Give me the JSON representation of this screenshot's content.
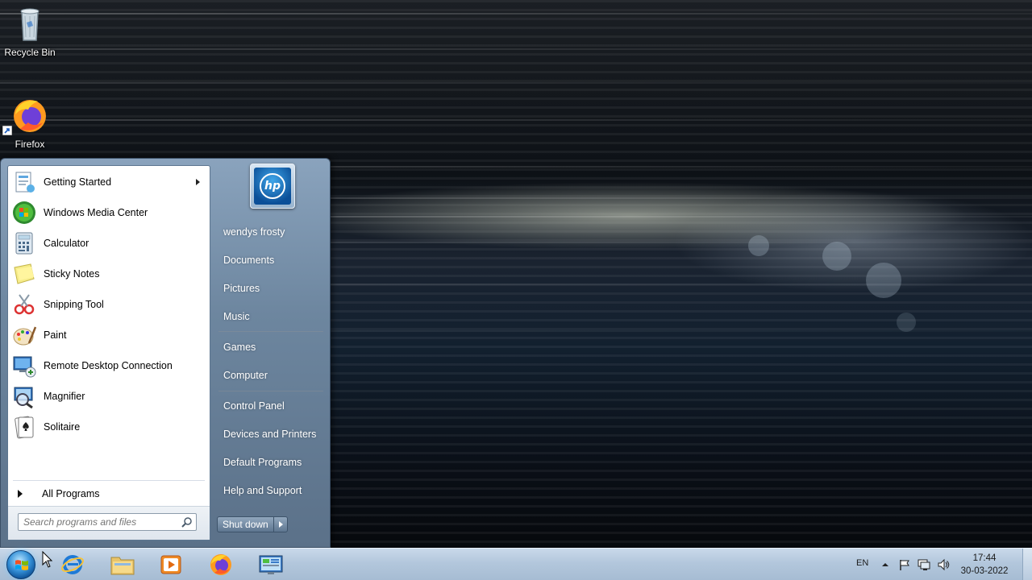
{
  "desktop": {
    "icons": [
      {
        "label": "Recycle Bin",
        "icon": "recycle-bin-icon"
      },
      {
        "label": "Firefox",
        "icon": "firefox-icon"
      }
    ]
  },
  "start_menu": {
    "programs": [
      {
        "label": "Getting Started",
        "icon": "getting-started-icon",
        "has_submenu": true
      },
      {
        "label": "Windows Media Center",
        "icon": "windows-media-center-icon"
      },
      {
        "label": "Calculator",
        "icon": "calculator-icon"
      },
      {
        "label": "Sticky Notes",
        "icon": "sticky-notes-icon"
      },
      {
        "label": "Snipping Tool",
        "icon": "snipping-tool-icon"
      },
      {
        "label": "Paint",
        "icon": "paint-icon"
      },
      {
        "label": "Remote Desktop Connection",
        "icon": "remote-desktop-icon"
      },
      {
        "label": "Magnifier",
        "icon": "magnifier-icon"
      },
      {
        "label": "Solitaire",
        "icon": "solitaire-icon"
      }
    ],
    "all_programs": "All Programs",
    "search_placeholder": "Search programs and files",
    "user_picture_text": "hp",
    "places": {
      "user": "wendys frosty",
      "documents": "Documents",
      "pictures": "Pictures",
      "music": "Music",
      "games": "Games",
      "computer": "Computer",
      "control_panel": "Control Panel",
      "devices": "Devices and Printers",
      "defaults": "Default Programs",
      "help": "Help and Support"
    },
    "shutdown_label": "Shut down"
  },
  "taskbar": {
    "pinned": [
      {
        "name": "Internet Explorer",
        "icon": "internet-explorer-icon"
      },
      {
        "name": "Windows Explorer",
        "icon": "file-explorer-icon"
      },
      {
        "name": "Windows Media Player",
        "icon": "media-player-icon"
      },
      {
        "name": "Firefox",
        "icon": "firefox-icon"
      },
      {
        "name": "Control Panel",
        "icon": "control-panel-icon"
      }
    ],
    "tray": {
      "language": "EN",
      "time": "17:44",
      "date": "30-03-2022"
    }
  },
  "colors": {
    "taskbar": "#b3c7dc",
    "start_menu_right": "#6d869f",
    "start_orb": "#3591d8"
  }
}
